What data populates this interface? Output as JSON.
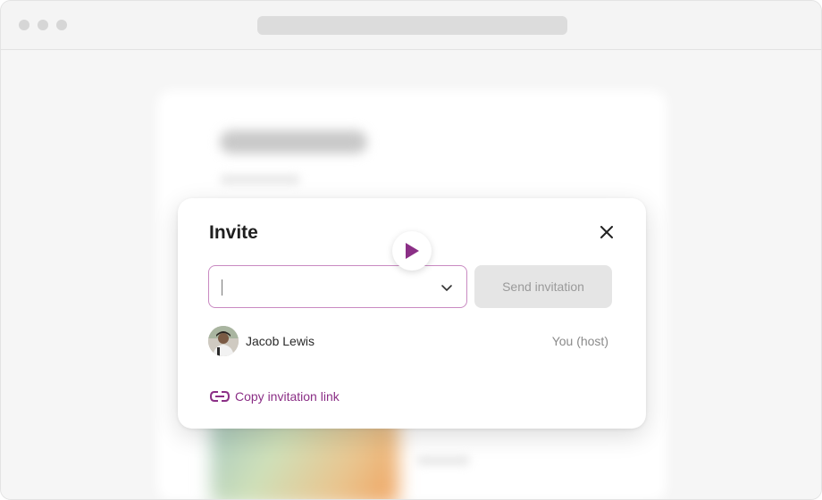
{
  "modal": {
    "title": "Invite",
    "input_value": "",
    "send_button_label": "Send invitation",
    "members": [
      {
        "name": "Jacob Lewis",
        "role": "You (host)"
      }
    ],
    "copy_link_label": "Copy invitation link"
  },
  "icons": {
    "close": "close-icon",
    "play": "play-icon",
    "chevron": "chevron-down-icon",
    "link": "link-icon"
  },
  "colors": {
    "accent": "#8b2f86",
    "input_border": "#c98ac2",
    "disabled_button": "#e5e5e5"
  }
}
